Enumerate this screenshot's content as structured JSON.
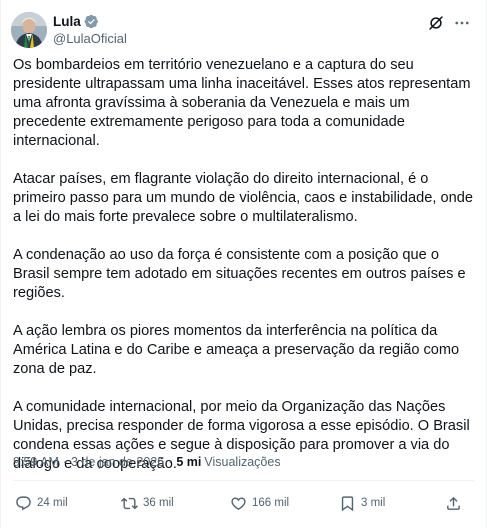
{
  "author": {
    "display_name": "Lula",
    "handle": "@LulaOficial",
    "verified_color": "#829aab"
  },
  "post": {
    "paragraphs": [
      "Os bombardeios em território venezuelano e a captura do seu presidente ultrapassam uma linha inaceitável. Esses atos representam uma afronta gravíssima à soberania da Venezuela e mais um precedente extremamente perigoso para toda a comunidade internacional.",
      "Atacar países, em flagrante violação do direito internacional, é o primeiro passo para um mundo de violência, caos e instabilidade, onde a lei do mais forte prevalece sobre o multilateralismo.",
      "A condenação ao uso da força é consistente com a posição que o Brasil sempre tem adotado em situações recentes em outros países e regiões.",
      "A ação lembra os piores momentos da interferência na política da América Latina e do Caribe e ameaça a preservação da região como zona de paz.",
      "A comunidade internacional, por meio da Organização das Nações Unidas, precisa responder de forma vigorosa a esse episódio. O Brasil condena essas ações e segue à disposição para promover a via do diálogo e da cooperação."
    ]
  },
  "meta": {
    "time": "9:59 AM",
    "separator": "·",
    "date": "3 de jan de 2026",
    "views_count": "5 mi",
    "views_label": "Visualizações"
  },
  "actions": {
    "replies": "24 mil",
    "reposts": "36 mil",
    "likes": "166 mil",
    "bookmarks": "3 mil"
  },
  "icons": {
    "avatar": "avatar-photo",
    "verified": "verified-badge-icon",
    "grok": "grok-icon",
    "more": "more-icon",
    "reply": "reply-icon",
    "repost": "repost-icon",
    "like": "heart-icon",
    "bookmark": "bookmark-icon",
    "share": "share-icon"
  },
  "colors": {
    "text_primary": "#0f1419",
    "text_secondary": "#536471",
    "divider": "#eff3f4"
  }
}
